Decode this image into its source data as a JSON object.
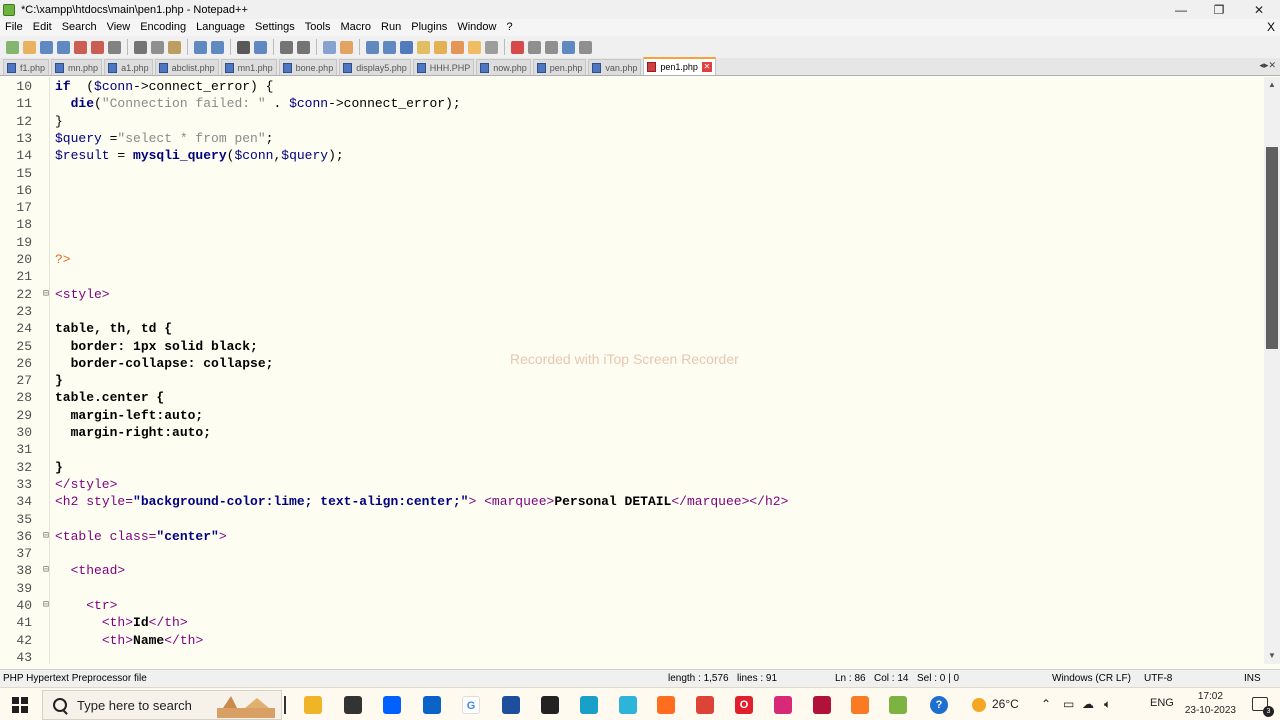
{
  "window": {
    "title": "*C:\\xampp\\htdocs\\main\\pen1.php - Notepad++",
    "controls": {
      "minimize": "—",
      "maximize": "❐",
      "close": "✕"
    }
  },
  "menu": {
    "items": [
      "File",
      "Edit",
      "Search",
      "View",
      "Encoding",
      "Language",
      "Settings",
      "Tools",
      "Macro",
      "Run",
      "Plugins",
      "Window",
      "?"
    ],
    "close": "X"
  },
  "tabs": [
    {
      "label": "f1.php",
      "active": false
    },
    {
      "label": "mn.php",
      "active": false
    },
    {
      "label": "a1.php",
      "active": false
    },
    {
      "label": "abclist.php",
      "active": false
    },
    {
      "label": "mn1.php",
      "active": false
    },
    {
      "label": "bone.php",
      "active": false
    },
    {
      "label": "display5.php",
      "active": false
    },
    {
      "label": "HHH.PHP",
      "active": false
    },
    {
      "label": "now.php",
      "active": false
    },
    {
      "label": "pen.php",
      "active": false
    },
    {
      "label": "van.php",
      "active": false
    },
    {
      "label": "pen1.php",
      "active": true
    }
  ],
  "editor": {
    "lines": [
      {
        "n": "10",
        "fold": "",
        "parts": [
          [
            "kw",
            "if"
          ],
          [
            "",
            "  ("
          ],
          [
            "var",
            "$conn"
          ],
          [
            "",
            "->connect_error) {"
          ]
        ]
      },
      {
        "n": "11",
        "fold": "",
        "parts": [
          [
            "",
            "  "
          ],
          [
            "fn",
            "die"
          ],
          [
            "",
            "("
          ],
          [
            "str",
            "\"Connection failed: \""
          ],
          [
            "",
            " . "
          ],
          [
            "var",
            "$conn"
          ],
          [
            "",
            "->connect_error);"
          ]
        ]
      },
      {
        "n": "12",
        "fold": "",
        "parts": [
          [
            "",
            "}"
          ]
        ]
      },
      {
        "n": "13",
        "fold": "",
        "parts": [
          [
            "var",
            "$query"
          ],
          [
            "",
            " ="
          ],
          [
            "str",
            "\"select * from pen\""
          ],
          [
            "",
            ";"
          ]
        ]
      },
      {
        "n": "14",
        "fold": "",
        "parts": [
          [
            "var",
            "$result"
          ],
          [
            "",
            " = "
          ],
          [
            "fn",
            "mysqli_query"
          ],
          [
            "",
            "("
          ],
          [
            "var",
            "$conn"
          ],
          [
            "",
            ","
          ],
          [
            "var",
            "$query"
          ],
          [
            "",
            ");"
          ]
        ]
      },
      {
        "n": "15",
        "fold": "",
        "parts": []
      },
      {
        "n": "16",
        "fold": "",
        "parts": []
      },
      {
        "n": "17",
        "fold": "",
        "parts": []
      },
      {
        "n": "18",
        "fold": "",
        "parts": []
      },
      {
        "n": "19",
        "fold": "",
        "parts": []
      },
      {
        "n": "20",
        "fold": "",
        "parts": [
          [
            "php",
            "?>"
          ]
        ]
      },
      {
        "n": "21",
        "fold": "",
        "parts": []
      },
      {
        "n": "22",
        "fold": "⊟",
        "parts": [
          [
            "tag",
            "<style>"
          ]
        ]
      },
      {
        "n": "23",
        "fold": "",
        "parts": []
      },
      {
        "n": "24",
        "fold": "",
        "parts": [
          [
            "b",
            "table, th, td {"
          ]
        ]
      },
      {
        "n": "25",
        "fold": "",
        "parts": [
          [
            "b",
            "  border: 1px solid black;"
          ]
        ]
      },
      {
        "n": "26",
        "fold": "",
        "parts": [
          [
            "b",
            "  border-collapse: collapse;"
          ]
        ]
      },
      {
        "n": "27",
        "fold": "",
        "parts": [
          [
            "b",
            "}"
          ]
        ]
      },
      {
        "n": "28",
        "fold": "",
        "parts": [
          [
            "b",
            "table.center {"
          ]
        ]
      },
      {
        "n": "29",
        "fold": "",
        "parts": [
          [
            "b",
            "  margin-left:auto;"
          ]
        ]
      },
      {
        "n": "30",
        "fold": "",
        "parts": [
          [
            "b",
            "  margin-right:auto;"
          ]
        ]
      },
      {
        "n": "31",
        "fold": "",
        "parts": []
      },
      {
        "n": "32",
        "fold": "",
        "parts": [
          [
            "b",
            "}"
          ]
        ]
      },
      {
        "n": "33",
        "fold": "",
        "parts": [
          [
            "tag",
            "</style>"
          ]
        ]
      },
      {
        "n": "34",
        "fold": "",
        "parts": [
          [
            "tag",
            "<h2 "
          ],
          [
            "attr",
            "style="
          ],
          [
            "aval",
            "\"background-color:lime; text-align:center;\""
          ],
          [
            "tag",
            "> <marquee>"
          ],
          [
            "b",
            "Personal DETAIL"
          ],
          [
            "tag",
            "</marquee></h2>"
          ]
        ]
      },
      {
        "n": "35",
        "fold": "",
        "parts": []
      },
      {
        "n": "36",
        "fold": "⊟",
        "parts": [
          [
            "tag",
            "<table "
          ],
          [
            "attr",
            "class="
          ],
          [
            "aval",
            "\"center\""
          ],
          [
            "tag",
            ">"
          ]
        ]
      },
      {
        "n": "37",
        "fold": "",
        "parts": []
      },
      {
        "n": "38",
        "fold": "⊟",
        "parts": [
          [
            "",
            "  "
          ],
          [
            "tag",
            "<thead>"
          ]
        ]
      },
      {
        "n": "39",
        "fold": "",
        "parts": []
      },
      {
        "n": "40",
        "fold": "⊟",
        "parts": [
          [
            "",
            "    "
          ],
          [
            "tag",
            "<tr>"
          ]
        ]
      },
      {
        "n": "41",
        "fold": "",
        "parts": [
          [
            "",
            "      "
          ],
          [
            "tag",
            "<th>"
          ],
          [
            "b",
            "Id"
          ],
          [
            "tag",
            "</th>"
          ]
        ]
      },
      {
        "n": "42",
        "fold": "",
        "parts": [
          [
            "",
            "      "
          ],
          [
            "tag",
            "<th>"
          ],
          [
            "b",
            "Name"
          ],
          [
            "tag",
            "</th>"
          ]
        ]
      },
      {
        "n": "43",
        "fold": "",
        "parts": []
      }
    ],
    "watermark": "Recorded with iTop Screen Recorder"
  },
  "status": {
    "filetype": "PHP Hypertext Preprocessor file",
    "length": "length : 1,576",
    "lines": "lines : 91",
    "ln": "Ln : 86",
    "col": "Col : 14",
    "sel": "Sel : 0 | 0",
    "eol": "Windows (CR LF)",
    "encoding": "UTF-8",
    "mode": "INS"
  },
  "taskbar": {
    "search_placeholder": "Type here to search",
    "apps": [
      {
        "name": "file-explorer",
        "color": "#f0b429",
        "glyph": ""
      },
      {
        "name": "store",
        "color": "#333333",
        "glyph": ""
      },
      {
        "name": "dropbox",
        "color": "#0061fe",
        "glyph": ""
      },
      {
        "name": "mail",
        "color": "#0a64c8",
        "glyph": ""
      },
      {
        "name": "google",
        "color": "#ffffff",
        "glyph": "G"
      },
      {
        "name": "app-blue",
        "color": "#1e4f9c",
        "glyph": ""
      },
      {
        "name": "app-dark",
        "color": "#222222",
        "glyph": ""
      },
      {
        "name": "edge",
        "color": "#18a0c8",
        "glyph": ""
      },
      {
        "name": "edge-dev",
        "color": "#2db4d8",
        "glyph": ""
      },
      {
        "name": "firefox",
        "color": "#ff6d1f",
        "glyph": ""
      },
      {
        "name": "chrome",
        "color": "#db4437",
        "glyph": ""
      },
      {
        "name": "opera",
        "color": "#e0202c",
        "glyph": "O"
      },
      {
        "name": "instagram",
        "color": "#d62976",
        "glyph": ""
      },
      {
        "name": "app-red",
        "color": "#b0123a",
        "glyph": ""
      },
      {
        "name": "xampp",
        "color": "#fb7a24",
        "glyph": ""
      },
      {
        "name": "notepad-plus-plus",
        "color": "#7cb342",
        "glyph": ""
      }
    ],
    "weather": "26°C",
    "lang": "ENG",
    "time": "17:02",
    "date": "23-10-2023",
    "notif_count": "3"
  }
}
